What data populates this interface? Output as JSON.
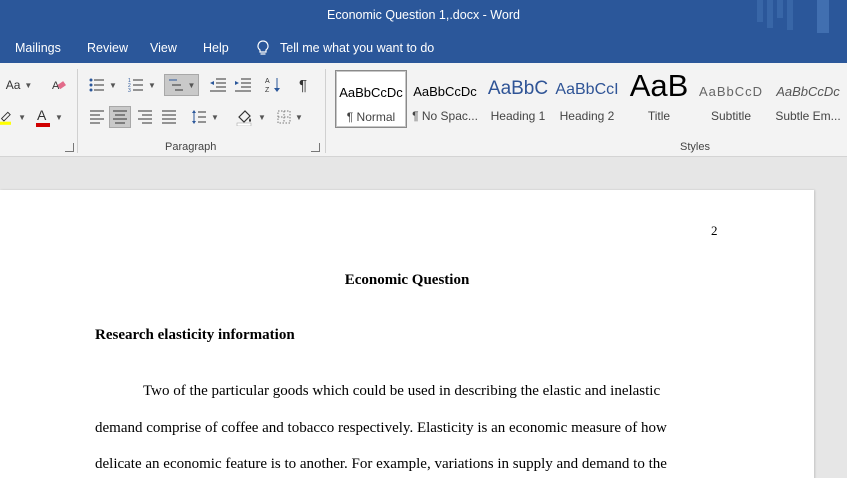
{
  "window": {
    "title": "Economic Question 1,.docx  -  Word"
  },
  "menu": {
    "items": [
      "Mailings",
      "Review",
      "View",
      "Help"
    ],
    "tell_me": "Tell me what you want to do"
  },
  "ribbon": {
    "font_group": {
      "change_case": "Aa"
    },
    "paragraph_label": "Paragraph",
    "styles_label": "Styles",
    "styles": [
      {
        "sample": "AaBbCcDc",
        "name": "¶ Normal"
      },
      {
        "sample": "AaBbCcDc",
        "name": "¶ No Spac..."
      },
      {
        "sample": "AaBbC",
        "name": "Heading 1"
      },
      {
        "sample": "AaBbCcI",
        "name": "Heading 2"
      },
      {
        "sample": "AaB",
        "name": "Title"
      },
      {
        "sample": "AaBbCcD",
        "name": "Subtitle"
      },
      {
        "sample": "AaBbCcDc",
        "name": "Subtle Em..."
      }
    ],
    "colors": {
      "highlight": "#ffff00",
      "font_color": "#d00000"
    }
  },
  "document": {
    "page_number": "2",
    "title": "Economic Question",
    "heading": "Research elasticity information",
    "lines": [
      "Two of the particular goods which could be used in describing the elastic and inelastic",
      "demand comprise of coffee and tobacco respectively. Elasticity is an economic measure of how",
      "delicate an economic feature is to another. For example, variations in supply and demand to the"
    ]
  },
  "theme": {
    "accent": "#2b579a"
  }
}
